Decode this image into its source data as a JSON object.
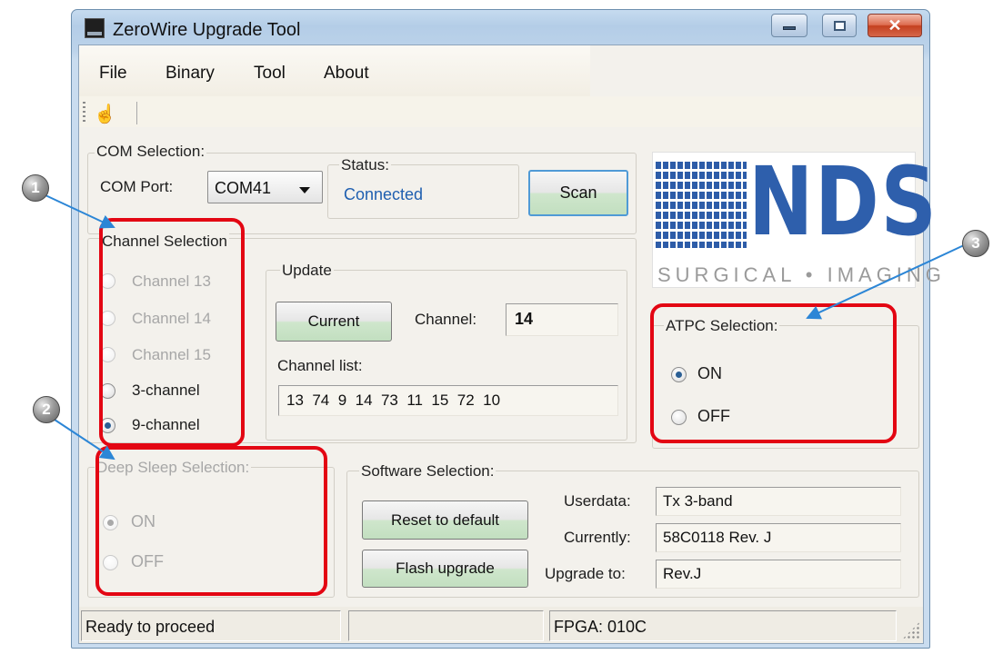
{
  "window": {
    "title": "ZeroWire Upgrade Tool",
    "close_glyph": "✕"
  },
  "menu": {
    "items": [
      "File",
      "Binary",
      "Tool",
      "About"
    ]
  },
  "toolbar": {
    "icon": "hand-pointer-icon",
    "icon_glyph": "☝"
  },
  "com_selection": {
    "group_label": "COM Selection:",
    "port_label": "COM Port:",
    "port_value": "COM41",
    "status_label": "Status:",
    "status_value": "Connected",
    "scan_label": "Scan"
  },
  "channel_selection": {
    "group_label": "Channel Selection",
    "options": [
      {
        "label": "Channel 13",
        "enabled": false,
        "selected": false
      },
      {
        "label": "Channel 14",
        "enabled": false,
        "selected": false
      },
      {
        "label": "Channel 15",
        "enabled": false,
        "selected": false
      },
      {
        "label": "3-channel",
        "enabled": true,
        "selected": false
      },
      {
        "label": "9-channel",
        "enabled": true,
        "selected": true
      }
    ]
  },
  "update": {
    "group_label": "Update",
    "current_label": "Current",
    "channel_label": "Channel:",
    "channel_value": "14",
    "channel_list_label": "Channel list:",
    "channel_list_value": "13  74  9  14  73  11  15  72  10"
  },
  "logo": {
    "main": "NDS",
    "sub": "SURGICAL • IMAGING"
  },
  "atpc_selection": {
    "group_label": "ATPC Selection:",
    "options": [
      {
        "label": "ON",
        "selected": true
      },
      {
        "label": "OFF",
        "selected": false
      }
    ]
  },
  "deep_sleep_selection": {
    "group_label": "Deep Sleep Selection:",
    "options": [
      {
        "label": "ON",
        "selected": true
      },
      {
        "label": "OFF",
        "selected": false
      }
    ]
  },
  "software_selection": {
    "group_label": "Software Selection:",
    "reset_label": "Reset to default",
    "flash_label": "Flash upgrade",
    "userdata_label": "Userdata:",
    "userdata_value": "Tx 3-band",
    "currently_label": "Currently:",
    "currently_value": "58C0118 Rev. J",
    "upgrade_label": "Upgrade to:",
    "upgrade_value": "Rev.J"
  },
  "statusbar": {
    "message": "Ready to proceed",
    "middle": "",
    "fpga": "FPGA: 010C"
  },
  "annotations": {
    "badges": [
      "1",
      "2",
      "3"
    ],
    "color": "#e30613"
  },
  "colors": {
    "accent_blue": "#1f5fb0",
    "logo_blue": "#2e5fac"
  }
}
